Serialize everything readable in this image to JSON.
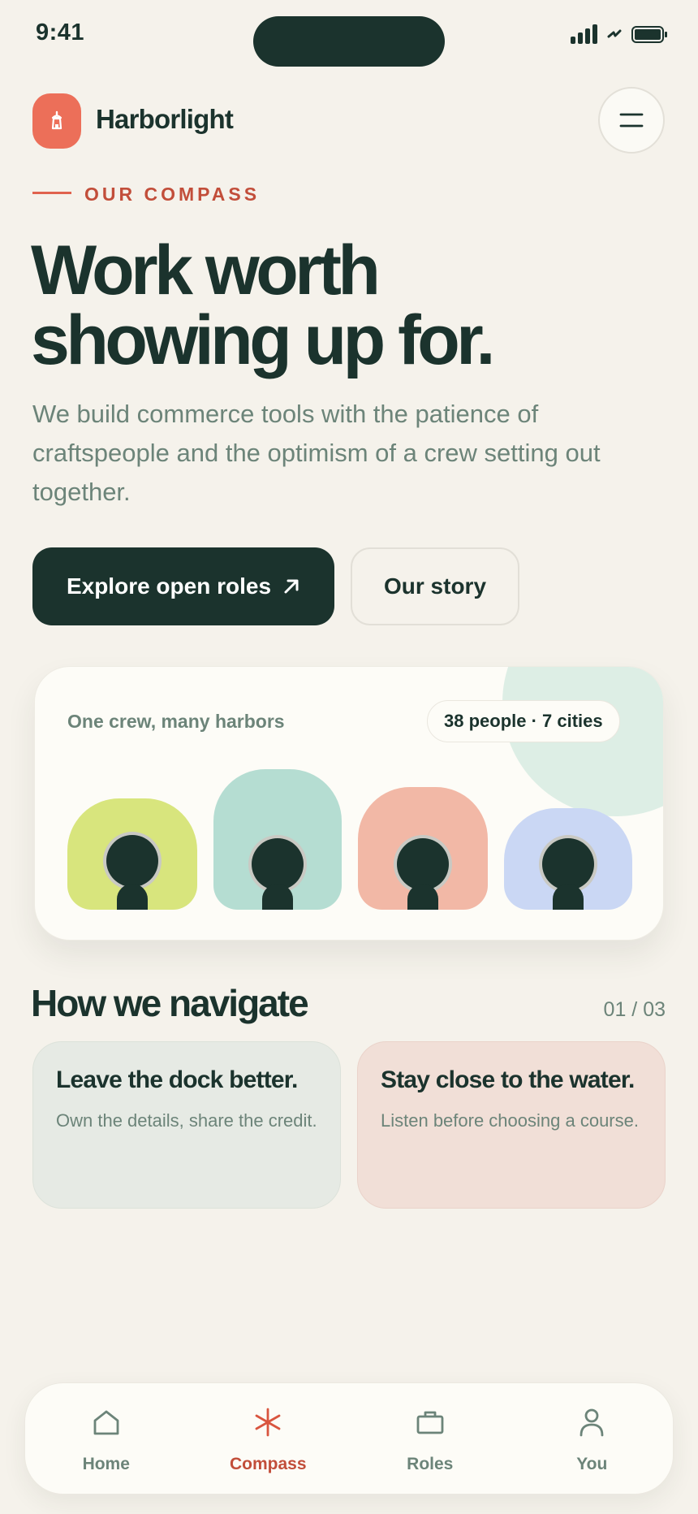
{
  "status_bar": {
    "time": "9:41"
  },
  "header": {
    "brand": "Harborlight",
    "logo_icon": "lighthouse-icon",
    "menu_icon": "hamburger-icon"
  },
  "hero": {
    "eyebrow": "OUR COMPASS",
    "title_line1": "Work worth",
    "title_line2": "showing up for.",
    "subtitle": "We build commerce tools with the patience of craftspeople and the optimism of a crew setting out together."
  },
  "cta": {
    "primary_label": "Explore open roles",
    "primary_icon": "arrow-up-right-icon",
    "secondary_label": "Our story"
  },
  "crew_card": {
    "label": "One crew, many harbors",
    "stat": "38 people · 7 cities",
    "avatar_colors": [
      "#D8E57D",
      "#B5DDD2",
      "#F2B8A6",
      "#CAD7F4"
    ]
  },
  "values": {
    "title": "How we navigate",
    "counter": "01 / 03",
    "items": [
      {
        "title": "Leave the dock better.",
        "text": "Own the details, share the credit."
      },
      {
        "title": "Stay close to the water.",
        "text": "Listen before choosing a course."
      }
    ]
  },
  "nav": {
    "items": [
      {
        "label": "Home",
        "icon": "home-icon"
      },
      {
        "label": "Compass",
        "icon": "asterisk-icon"
      },
      {
        "label": "Roles",
        "icon": "briefcase-icon"
      },
      {
        "label": "You",
        "icon": "person-icon"
      }
    ],
    "active": "Compass"
  },
  "colors": {
    "background": "#F5F2EB",
    "ink": "#1B332D",
    "accent": "#EC6F59",
    "accent_text": "#C24E3A",
    "muted": "#6C8479"
  }
}
